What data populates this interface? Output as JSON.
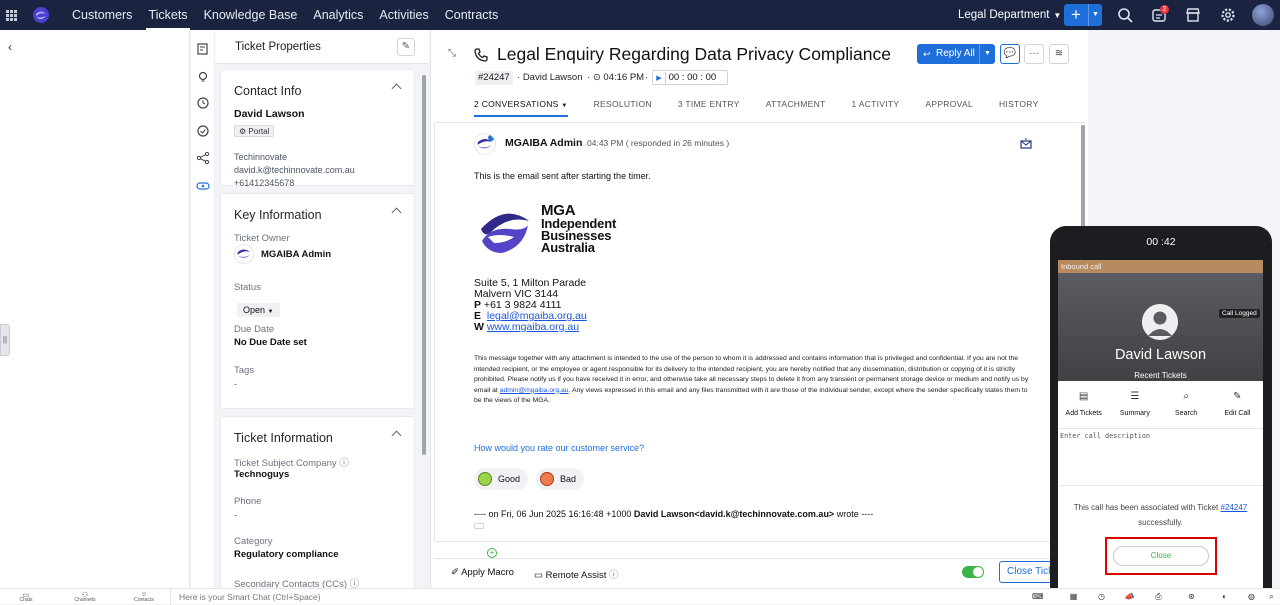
{
  "topbar": {
    "nav": [
      "Customers",
      "Tickets",
      "Knowledge Base",
      "Analytics",
      "Activities",
      "Contracts"
    ],
    "active_nav": "Tickets",
    "department": "Legal Department",
    "notification_count": "2"
  },
  "properties": {
    "title": "Ticket Properties",
    "contact": {
      "section_title": "Contact Info",
      "name": "David Lawson",
      "badge": "Portal",
      "company": "Techinnovate",
      "email": "david.k@techinnovate.com.au",
      "phone": "+61412345678"
    },
    "key_info": {
      "section_title": "Key Information",
      "owner_label": "Ticket Owner",
      "owner": "MGAIBA Admin",
      "status_label": "Status",
      "status": "Open",
      "due_label": "Due Date",
      "due": "No Due Date set",
      "tags_label": "Tags",
      "tags": "-"
    },
    "ticket_info": {
      "section_title": "Ticket Information",
      "subject_company_label": "Ticket Subject Company",
      "subject_company": "Technoguys",
      "phone_label": "Phone",
      "phone": "-",
      "category_label": "Category",
      "category": "Regulatory compliance",
      "ccs_label": "Secondary Contacts (CCs)"
    }
  },
  "ticket": {
    "title": "Legal Enquiry Regarding Data Privacy Compliance",
    "id": "#24247",
    "contact": "David Lawson",
    "time": "04:16 PM",
    "timer": "00 : 00 : 00",
    "reply_label": "Reply All",
    "tabs": [
      "2 CONVERSATIONS",
      "RESOLUTION",
      "3 TIME ENTRY",
      "ATTACHMENT",
      "1 ACTIVITY",
      "APPROVAL",
      "HISTORY"
    ]
  },
  "conversation": {
    "sender": "MGAIBA Admin",
    "sent": "04:43 PM ( responded in 26 minutes )",
    "body": "This is the email sent after starting the timer.",
    "brand_lines": [
      "MGA",
      "Independent",
      "Businesses",
      "Australia"
    ],
    "address_1": "Suite 5, 1 Milton Parade",
    "address_2": "Malvern VIC  3144",
    "phone_prefix": "P",
    "phone": " +61 3 9824 4111",
    "email_prefix": "E",
    "email": "legal@mgaiba.org.au",
    "web_prefix": "W",
    "web": "www.mgaiba.org.au",
    "disclaimer_a": "This message together with any attachment is intended to the use of the person to whom it is addressed and contains information that is privileged and confidential. If you are not the intended recipient, or the employee or agent responsible for its delivery to the intended recipient, you are hereby notified that any dissemination, distribution or copying of it is strictly prohibited. Please notify us if you have received it in error, and otherwise take all necessary steps to delete it from any transient or permanent storage device or medium and notify us by email at ",
    "disclaimer_link": "admin@mgaiba.org.au",
    "disclaimer_b": ". Any views expressed in this email and any files transmitted with it are those of the individual sender, except where the sender specifically states them to be the views of the MGA.",
    "rating_prompt": "How would you rate our customer service?",
    "good": "Good",
    "bad": "Bad",
    "quote_prefix": "---- on Fri, 06 Jun 2025 16:16:48 +1000 ",
    "quote_sender": "David Lawson<david.k@techinnovate.com.au>",
    "quote_suffix": " wrote ----"
  },
  "footer": {
    "macro": "Apply Macro",
    "assist": "Remote Assist",
    "close_ticket": "Close Ticket"
  },
  "phone": {
    "time": "00 :42",
    "inbound": "Inbound call",
    "call_logged": "Call Logged",
    "caller": "David Lawson",
    "recent": "Recent Tickets",
    "actions": [
      "Add Tickets",
      "Summary",
      "Search",
      "Edit Call"
    ],
    "placeholder": "Enter call description",
    "assoc_a": "This call has been associated with Ticket ",
    "assoc_link": "#24247",
    "assoc_b": "successfully.",
    "close": "Close"
  },
  "bottombar": {
    "items": [
      "Chats",
      "Channels",
      "Contacts"
    ],
    "smartchat": "Here is your Smart Chat (Ctrl+Space)"
  },
  "colors": {
    "topbar": "#1a2440",
    "accent": "#1f6fdb",
    "highlight": "#dd0000"
  }
}
